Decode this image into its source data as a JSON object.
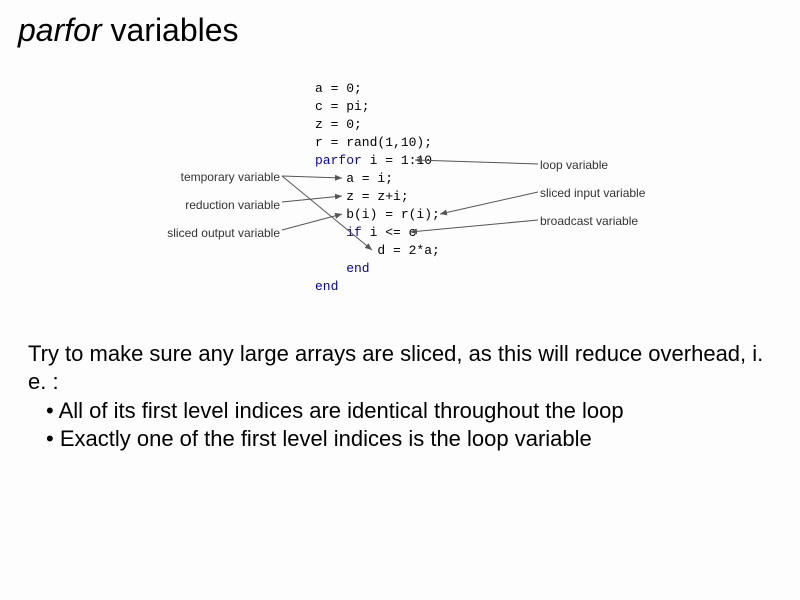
{
  "title": {
    "keyword": "parfor",
    "rest": " variables"
  },
  "code": {
    "l1": "a = 0;",
    "l2": "c = pi;",
    "l3": "z = 0;",
    "l4": "r = rand(1,10);",
    "l5a": "parfor",
    "l5b": " i = 1:10",
    "l6": "    a = i;",
    "l7": "    z = z+i;",
    "l8": "    b(i) = r(i);",
    "l9a": "    if",
    "l9b": " i <= c",
    "l10": "        d = 2*a;",
    "l11a": "    end",
    "l12a": "end"
  },
  "labels": {
    "left": {
      "temp": "temporary variable",
      "reduction": "reduction variable",
      "sliced_out": "sliced output variable"
    },
    "right": {
      "loop": "loop variable",
      "sliced_in": "sliced input variable",
      "broadcast": "broadcast variable"
    }
  },
  "body": {
    "p1": "Try to make sure any large arrays are sliced, as this will reduce overhead, i. e. :",
    "b1": "All of its first level indices are identical throughout the loop",
    "b2": "Exactly one of the first level indices is the loop variable"
  }
}
